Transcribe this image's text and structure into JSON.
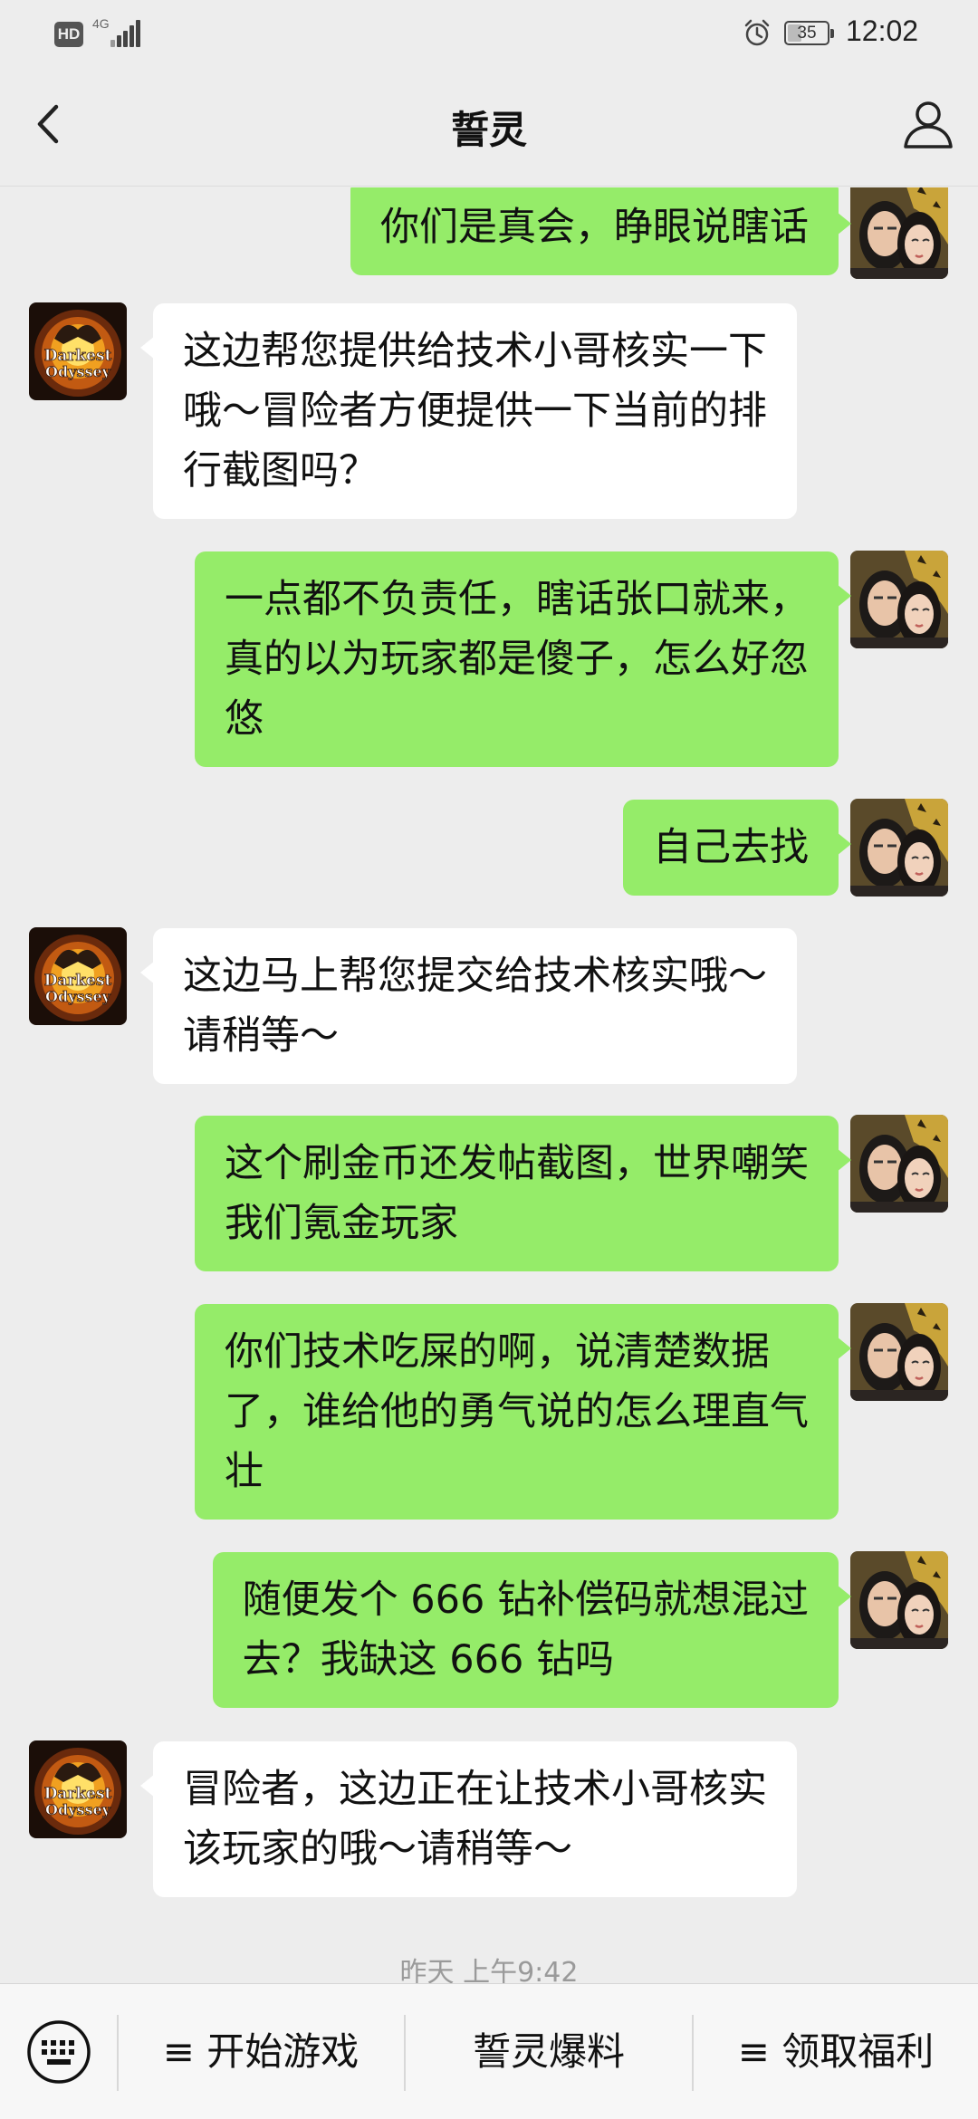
{
  "status_bar": {
    "hd": "HD",
    "network": "4G",
    "battery": "35",
    "battery_level": 0.35,
    "time": "12:02",
    "icons": [
      "signal-icon",
      "alarm-icon",
      "battery-icon"
    ]
  },
  "header": {
    "title": "誓灵",
    "icons": [
      "back-icon",
      "profile-icon"
    ]
  },
  "messages": [
    {
      "sender": "user",
      "text": "你们是真会，睁眼说瞎话"
    },
    {
      "sender": "bot",
      "text": "这边帮您提供给技术小哥核实一下\n哦～冒险者方便提供一下当前的排\n行截图吗？"
    },
    {
      "sender": "user",
      "text": "一点都不负责任，瞎话张口就来，\n真的以为玩家都是傻子，怎么好忽\n悠"
    },
    {
      "sender": "user",
      "text": "自己去找"
    },
    {
      "sender": "bot",
      "text": "这边马上帮您提交给技术核实哦～\n请稍等～"
    },
    {
      "sender": "user",
      "text": "这个刷金币还发帖截图，世界嘲笑\n我们氪金玩家"
    },
    {
      "sender": "user",
      "text": "你们技术吃屎的啊，说清楚数据\n了，谁给他的勇气说的怎么理直气\n壮"
    },
    {
      "sender": "user",
      "text": "随便发个 666 钻补偿码就想混过\n去？我缺这 666 钻吗"
    },
    {
      "sender": "bot",
      "text": "冒险者，这边正在让技术小哥核实\n该玩家的哦～请稍等～"
    }
  ],
  "timestamp": "昨天 上午9:42",
  "bot_avatar": {
    "logo_line1": "Darkest",
    "logo_line2": "Odyssey"
  },
  "bottom_menu": {
    "keyboard_icon": "keyboard-icon",
    "items": [
      {
        "label": "≡ 开始游戏"
      },
      {
        "label": "誓灵爆料"
      },
      {
        "label": "≡ 领取福利"
      }
    ]
  },
  "colors": {
    "background": "#ededed",
    "user_bubble": "#95ec69",
    "bot_bubble": "#ffffff",
    "timestamp": "#9a9a9a"
  }
}
